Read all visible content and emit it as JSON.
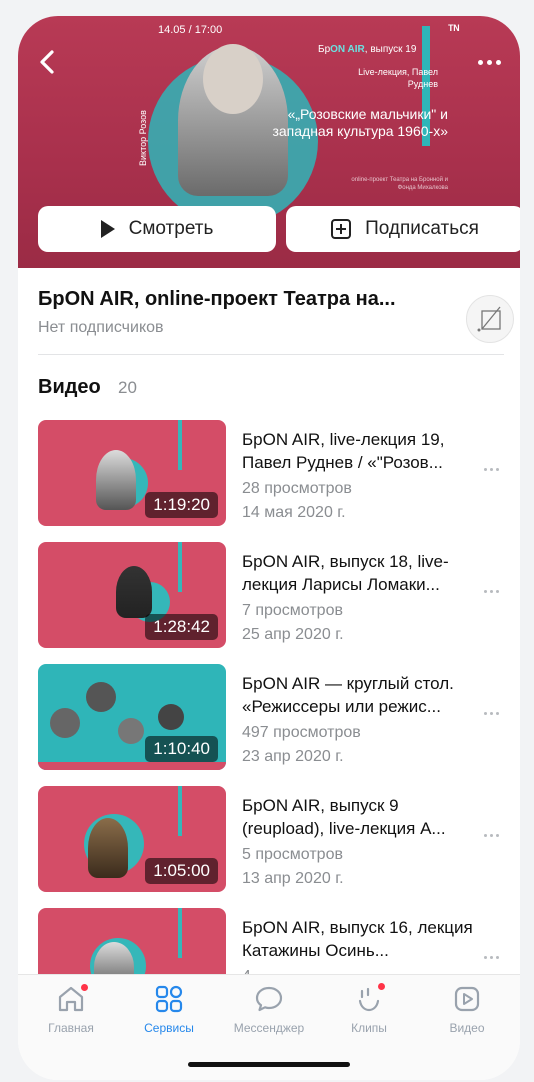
{
  "cover": {
    "date": "14.05 / 17:00",
    "logo": "ᵀᴺ",
    "episode_prefix": "Бр",
    "episode_on": "ON AIR",
    "episode_suffix": ", выпуск 19",
    "lecture": "Live-лекция, Павел Руднев",
    "topic": "«„Розовские мальчики\" и западная культура 1960-х»",
    "vertical_text": "Виктор Розов",
    "small_text": "online-проект Театра на Бронной и Фонда Михалкова"
  },
  "actions": {
    "watch_label": "Смотреть",
    "subscribe_label": "Подписаться"
  },
  "group": {
    "title": "БрON AIR, online-проект Театра на...",
    "subscribers": "Нет подписчиков"
  },
  "videos_section": {
    "title": "Видео",
    "count": "20"
  },
  "videos": [
    {
      "title": "БрON AIR, live-лекция 19, Павел Руднев / «\"Розов...",
      "views": "28 просмотров",
      "date": "14 мая 2020 г.",
      "duration": "1:19:20"
    },
    {
      "title": "БрON AIR, выпуск 18, live-лекция Ларисы Ломаки...",
      "views": "7 просмотров",
      "date": "25 апр 2020 г.",
      "duration": "1:28:42"
    },
    {
      "title": "БрON AIR — круглый стол. «Режиссеры или режис...",
      "views": "497 просмотров",
      "date": "23 апр 2020 г.",
      "duration": "1:10:40"
    },
    {
      "title": "БрON AIR, выпуск 9 (reupload), live-лекция А...",
      "views": "5 просмотров",
      "date": "13 апр 2020 г.",
      "duration": "1:05:00"
    },
    {
      "title": "БрON AIR, выпуск 16, лекция Катажины Осинь...",
      "views": "4 ...",
      "date": "",
      "duration": ""
    }
  ],
  "tabs": [
    {
      "label": "Главная",
      "icon": "home-icon"
    },
    {
      "label": "Сервисы",
      "icon": "services-icon"
    },
    {
      "label": "Мессенджер",
      "icon": "messenger-icon"
    },
    {
      "label": "Клипы",
      "icon": "clips-icon"
    },
    {
      "label": "Видео",
      "icon": "video-icon"
    }
  ],
  "colors": {
    "cover_bg": "#b83a55",
    "accent_teal": "#2fb5b8",
    "active_tab": "#2688eb",
    "inactive_tab": "#99a2ad",
    "badge_red": "#ff3347"
  }
}
